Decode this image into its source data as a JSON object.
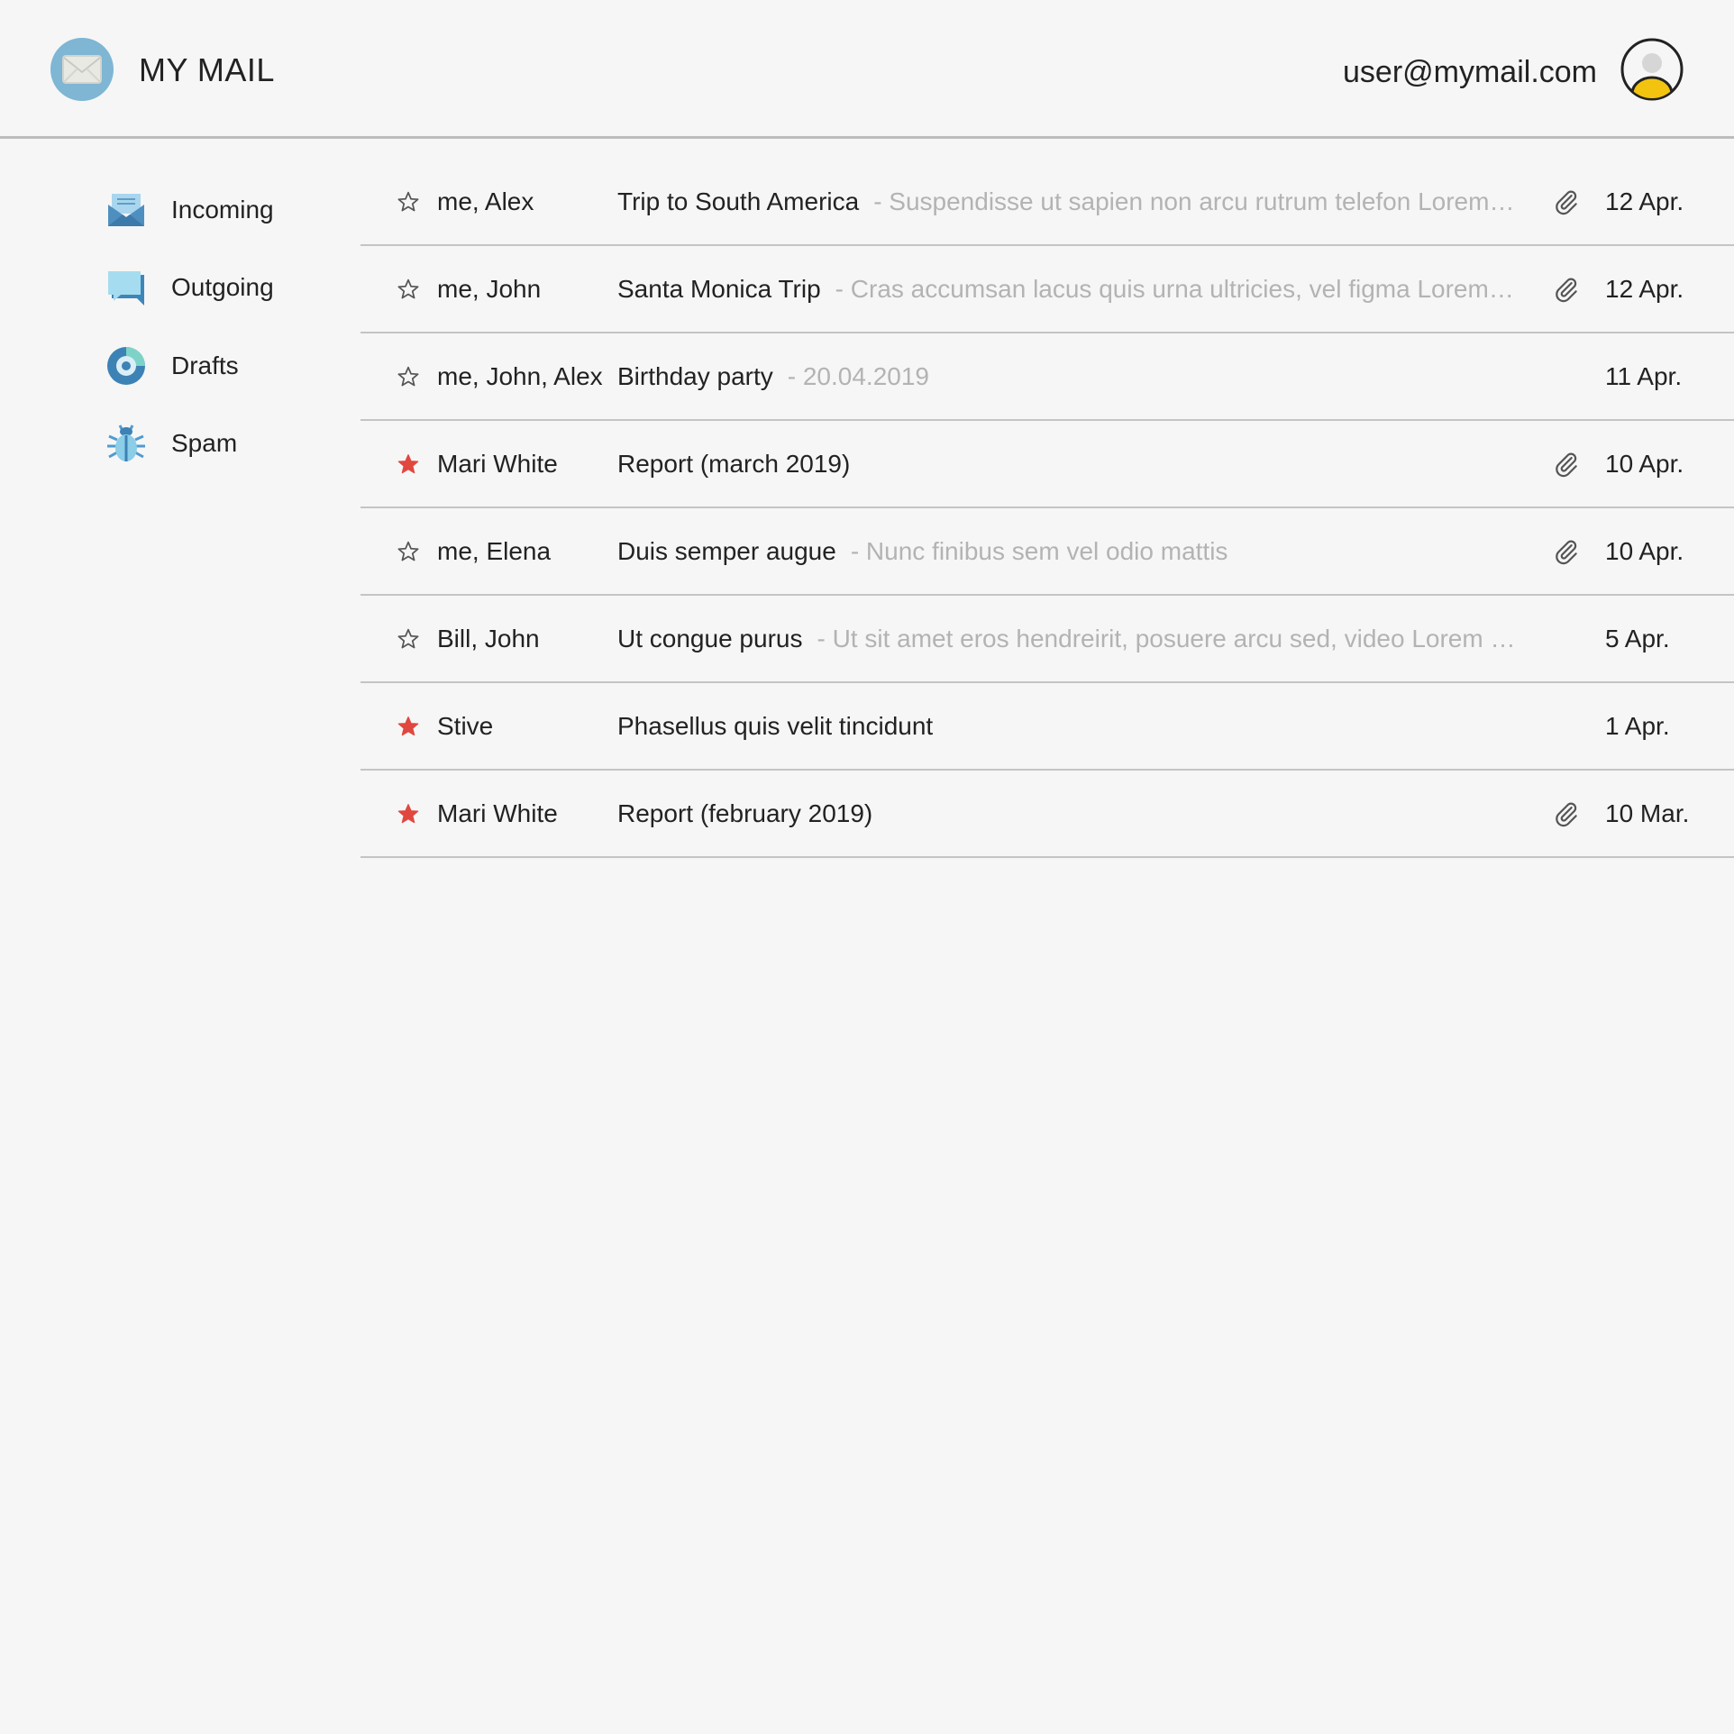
{
  "header": {
    "app_title": "MY MAIL",
    "user_email": "user@mymail.com"
  },
  "sidebar": {
    "items": [
      {
        "label": "Incoming",
        "icon": "inbox-envelope-icon"
      },
      {
        "label": "Outgoing",
        "icon": "outgoing-chat-icon"
      },
      {
        "label": "Drafts",
        "icon": "drafts-disc-icon"
      },
      {
        "label": "Spam",
        "icon": "spam-bug-icon"
      }
    ]
  },
  "colors": {
    "background": "#f6f6f6",
    "star_active": "#e0473f",
    "preview_text": "#b3b3b3",
    "logo_bg": "#7eb6d4",
    "avatar_accent": "#f2c40f"
  },
  "emails": [
    {
      "starred": false,
      "from": "me, Alex",
      "subject": "Trip to South America",
      "preview": "- Suspendisse ut sapien non arcu rutrum telefon Lorem i...",
      "attachment": true,
      "date": "12 Apr."
    },
    {
      "starred": false,
      "from": "me, John",
      "subject": "Santa Monica Trip",
      "preview": "- Cras accumsan lacus quis urna ultricies, vel figma Lorem ips...",
      "attachment": true,
      "date": "12 Apr."
    },
    {
      "starred": false,
      "from": "me, John, Alex",
      "subject": "Birthday party",
      "preview": "- 20.04.2019",
      "attachment": false,
      "date": "11 Apr."
    },
    {
      "starred": true,
      "from": "Mari White",
      "subject": "Report (march 2019)",
      "preview": "",
      "attachment": true,
      "date": "10 Apr."
    },
    {
      "starred": false,
      "from": "me, Elena",
      "subject": "Duis semper augue",
      "preview": "- Nunc finibus sem vel odio mattis",
      "attachment": true,
      "date": "10 Apr."
    },
    {
      "starred": false,
      "from": "Bill, John",
      "subject": "Ut congue purus",
      "preview": "- Ut sit amet eros hendreirit, posuere arcu sed, video Lorem ip...",
      "attachment": false,
      "date": "5 Apr."
    },
    {
      "starred": true,
      "from": "Stive",
      "subject": "Phasellus quis velit tincidunt",
      "preview": "",
      "attachment": false,
      "date": "1 Apr."
    },
    {
      "starred": true,
      "from": "Mari White",
      "subject": "Report (february 2019)",
      "preview": "",
      "attachment": true,
      "date": "10 Mar."
    }
  ]
}
